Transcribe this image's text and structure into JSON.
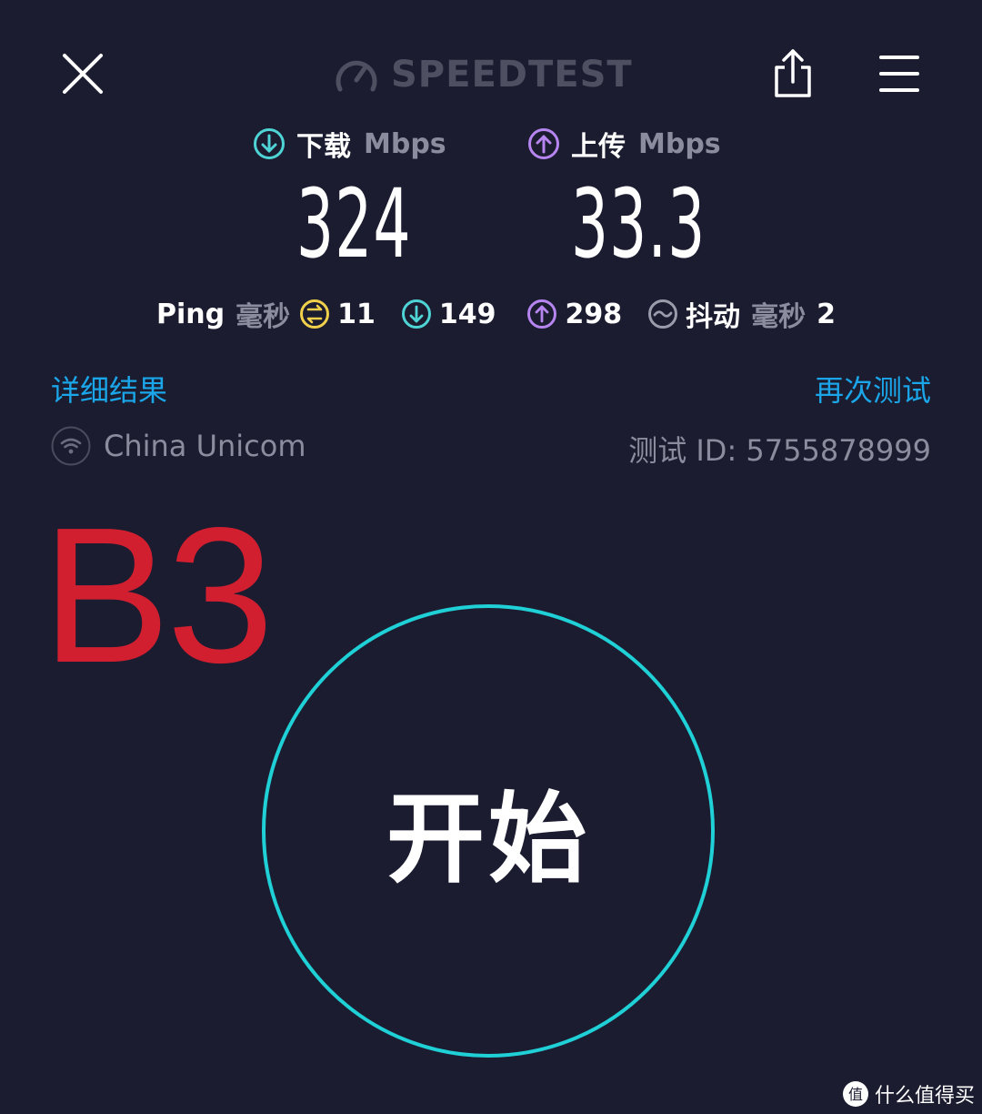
{
  "header": {
    "logo_text": "SPEEDTEST"
  },
  "download": {
    "label": "下载",
    "unit": "Mbps",
    "value": "324"
  },
  "upload": {
    "label": "上传",
    "unit": "Mbps",
    "value": "33.3"
  },
  "ping": {
    "label": "Ping",
    "unit": "毫秒",
    "idle": "11",
    "download": "149",
    "upload": "298",
    "jitter_label": "抖动",
    "jitter_unit": "毫秒",
    "jitter": "2"
  },
  "links": {
    "details": "详细结果",
    "retest": "再次测试"
  },
  "connection": {
    "isp": "China Unicom",
    "test_id": "测试 ID: 5755878999"
  },
  "overlay_label": "B3",
  "start_button": {
    "label": "开始"
  },
  "watermark": {
    "text": "什么值得买",
    "logo_glyph": "值"
  },
  "colors": {
    "background": "#1b1c30",
    "download_accent": "#4fd4d6",
    "upload_accent": "#b685f0",
    "ping_accent": "#f0d04a",
    "link": "#1aa6e8",
    "ring": "#1fd1d6",
    "overlay": "#d21f30"
  },
  "icons": {
    "close": "close-icon",
    "logo": "speedometer-icon",
    "share": "share-icon",
    "menu": "menu-icon",
    "download": "download-arrow-icon",
    "upload": "upload-arrow-icon",
    "ping": "ping-icon",
    "jitter": "jitter-icon",
    "wifi": "wifi-icon"
  }
}
